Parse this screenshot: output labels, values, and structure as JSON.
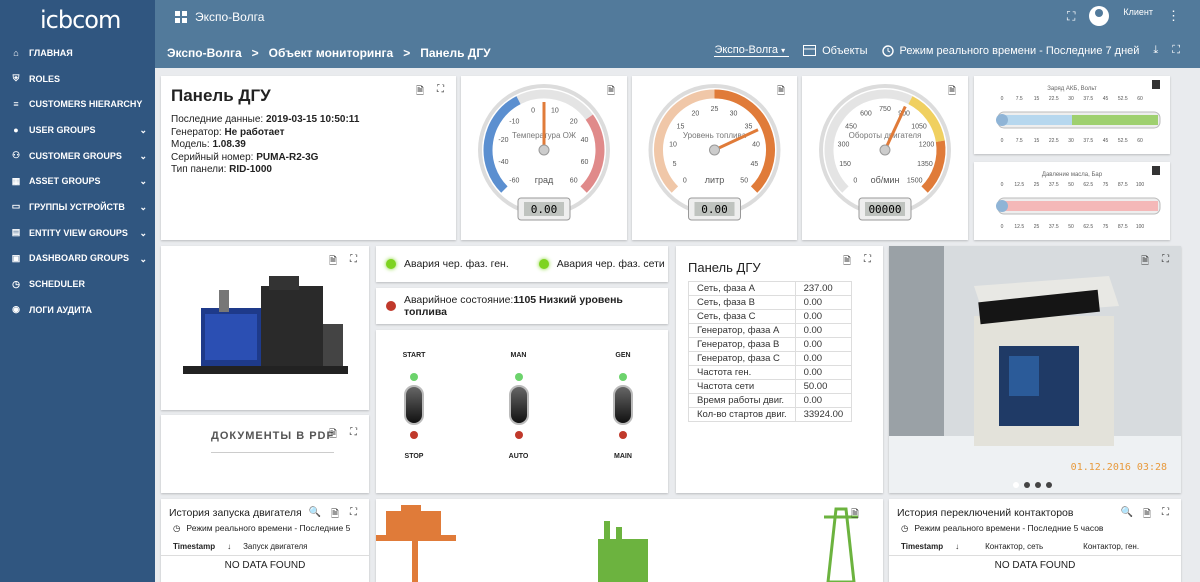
{
  "app": {
    "logo": "icbcom",
    "title": "Экспо-Волга",
    "user": "Клиент"
  },
  "sidebar": {
    "items": [
      {
        "label": "ГЛАВНАЯ",
        "icon": "home-icon",
        "chev": false
      },
      {
        "label": "ROLES",
        "icon": "shield-icon",
        "chev": false
      },
      {
        "label": "CUSTOMERS HIERARCHY",
        "icon": "lines-icon",
        "chev": false
      },
      {
        "label": "USER GROUPS",
        "icon": "user-icon",
        "chev": true
      },
      {
        "label": "CUSTOMER GROUPS",
        "icon": "users-icon",
        "chev": true
      },
      {
        "label": "ASSET GROUPS",
        "icon": "domain-icon",
        "chev": true
      },
      {
        "label": "ГРУППЫ УСТРОЙСТВ",
        "icon": "devices-icon",
        "chev": true
      },
      {
        "label": "ENTITY VIEW GROUPS",
        "icon": "view-icon",
        "chev": true
      },
      {
        "label": "DASHBOARD GROUPS",
        "icon": "dashboard-icon",
        "chev": true
      },
      {
        "label": "SCHEDULER",
        "icon": "clock-icon",
        "chev": false
      },
      {
        "label": "ЛОГИ АУДИТА",
        "icon": "audit-icon",
        "chev": false
      }
    ]
  },
  "breadcrumb": {
    "a": "Экспо-Волга",
    "b": "Объект мониторинга",
    "c": "Панель ДГУ",
    "sep": ">"
  },
  "toolbar": {
    "entity": "Экспо-Волга",
    "objects": "Объекты",
    "time": "Режим реального времени - Последние 7 дней"
  },
  "info": {
    "title": "Панель ДГУ",
    "rows": [
      {
        "k": "Последние данные: ",
        "v": "2019-03-15 10:50:11"
      },
      {
        "k": "Генератор: ",
        "v": "Не работает"
      },
      {
        "k": "Модель: ",
        "v": "1.08.39"
      },
      {
        "k": "Серийный номер: ",
        "v": "PUMA-R2-3G"
      },
      {
        "k": "Тип панели: ",
        "v": "RID-1000"
      }
    ]
  },
  "gauges": [
    {
      "label": "Температура ОЖ",
      "unit": "град",
      "ticks": [
        "-60",
        "-40",
        "-20",
        "-10",
        "0",
        "10",
        "20",
        "40",
        "60",
        "60"
      ],
      "value": "0.00",
      "needle": 0
    },
    {
      "label": "Уровень топлива",
      "unit": "литр",
      "ticks": [
        "0",
        "5",
        "10",
        "15",
        "20",
        "25",
        "30",
        "35",
        "40",
        "45",
        "50"
      ],
      "value": "0.00",
      "needle": 0
    },
    {
      "label": "Обороты двигателя",
      "unit": "об/мин",
      "ticks": [
        "0",
        "150",
        "300",
        "450",
        "600",
        "750",
        "900",
        "1050",
        "1200",
        "1350",
        "1500"
      ],
      "value": "00000",
      "needle": 0
    }
  ],
  "bars": [
    {
      "title": "Заряд АКБ, Вольт",
      "ticks": [
        "0",
        "7.5",
        "15",
        "22.5",
        "30",
        "37.5",
        "45",
        "52.5",
        "60"
      ],
      "value": 0
    },
    {
      "title": "Давление масла, Бар",
      "ticks": [
        "0",
        "12.5",
        "25",
        "37.5",
        "50",
        "62.5",
        "75",
        "87.5",
        "100"
      ],
      "value": 0
    }
  ],
  "alarms": {
    "a1": "Авария чер. фаз. ген.",
    "a2": "Авария чер. фаз. сети",
    "state_k": "Аварийное состояние:",
    "state_v": "1105 Низкий уровень топлива"
  },
  "switches": [
    {
      "top": "START",
      "bottom": "STOP"
    },
    {
      "top": "MAN",
      "bottom": "AUTO"
    },
    {
      "top": "GEN",
      "bottom": "MAIN"
    }
  ],
  "docs": {
    "label": "ДОКУМЕНТЫ В PDF"
  },
  "panel_table": {
    "title": "Панель ДГУ",
    "rows": [
      [
        "Сеть, фаза А",
        "237.00"
      ],
      [
        "Сеть, фаза В",
        "0.00"
      ],
      [
        "Сеть, фаза С",
        "0.00"
      ],
      [
        "Генератор, фаза А",
        "0.00"
      ],
      [
        "Генератор, фаза В",
        "0.00"
      ],
      [
        "Генератор, фаза С",
        "0.00"
      ],
      [
        "Частота ген.",
        "0.00"
      ],
      [
        "Частота сети",
        "50.00"
      ],
      [
        "Время работы двиг.",
        "0.00"
      ],
      [
        "Кол-во стартов двиг.",
        "33924.00"
      ]
    ]
  },
  "photo": {
    "stamp": "01.12.2016 03:28"
  },
  "history1": {
    "title": "История запуска двигателя",
    "time": "Режим реального времени - Последние 5",
    "col1": "Timestamp",
    "col2": "Запуск двигателя",
    "empty": "NO DATA FOUND"
  },
  "history2": {
    "title": "История переключений контакторов",
    "time": "Режим реального времени - Последние 5 часов",
    "col1": "Timestamp",
    "col2": "Контактор, сеть",
    "col3": "Контактор, ген.",
    "empty": "NO DATA FOUND"
  },
  "colors": {
    "sidebar": "#305680",
    "topbar": "#527a9b",
    "green": "#7ed321",
    "red": "#c0392b",
    "orange": "#e07b39",
    "green2": "#6cb33f"
  }
}
